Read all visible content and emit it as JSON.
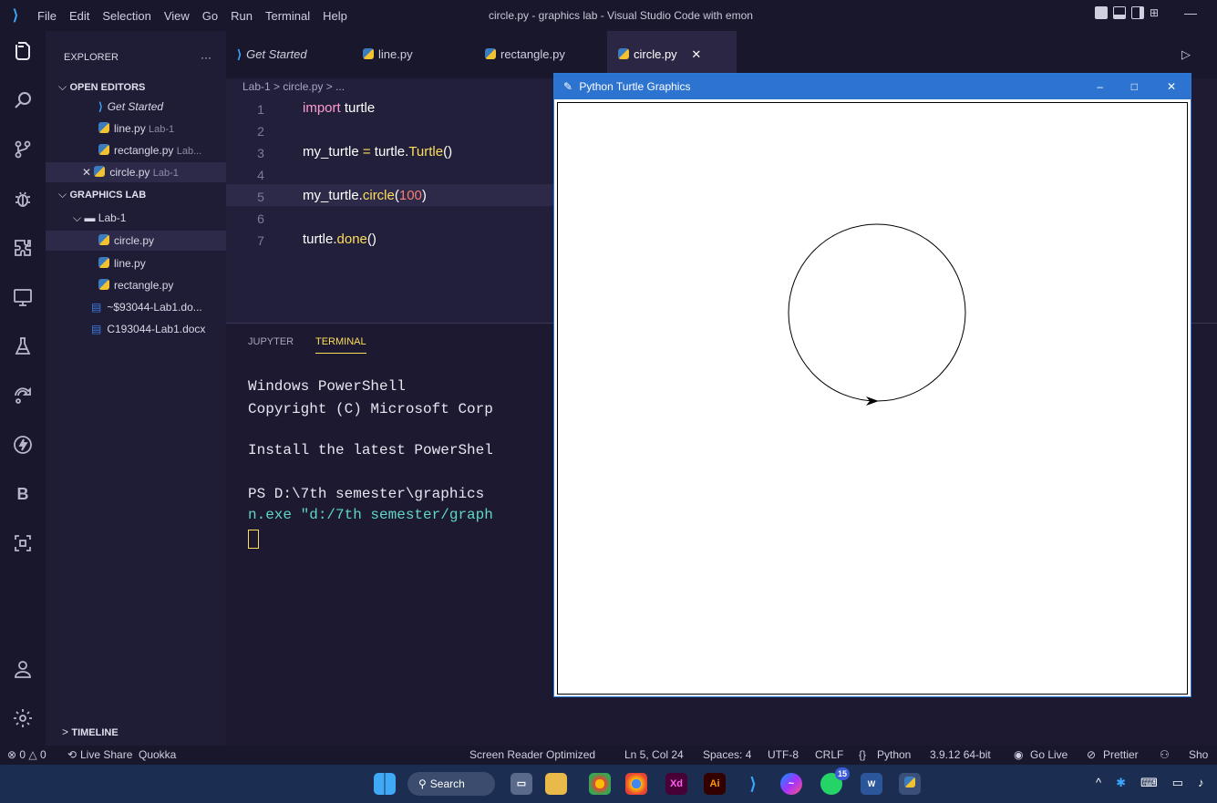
{
  "titlebar": {
    "menu": [
      "File",
      "Edit",
      "Selection",
      "View",
      "Go",
      "Run",
      "Terminal",
      "Help"
    ],
    "title": "circle.py - graphics lab - Visual Studio Code with emon"
  },
  "sidebar": {
    "explorer_label": "EXPLORER",
    "more": "···",
    "open_editors": "OPEN EDITORS",
    "open_items": [
      {
        "name": "Get Started",
        "desc": ""
      },
      {
        "name": "line.py",
        "desc": "Lab-1"
      },
      {
        "name": "rectangle.py",
        "desc": "Lab..."
      },
      {
        "name": "circle.py",
        "desc": "Lab-1"
      }
    ],
    "workspace": "GRAPHICS LAB",
    "folder": "Lab-1",
    "files": [
      "circle.py",
      "line.py",
      "rectangle.py"
    ],
    "docs": [
      "~$93044-Lab1.do...",
      "C193044-Lab1.docx"
    ],
    "timeline": "TIMELINE"
  },
  "tabs": [
    "Get Started",
    "line.py",
    "rectangle.py",
    "circle.py"
  ],
  "editor": {
    "breadcrumb": "Lab-1 > circle.py > ...",
    "line_numbers": [
      "1",
      "2",
      "3",
      "4",
      "5",
      "6",
      "7"
    ]
  },
  "panel": {
    "tabs": [
      "JUPYTER",
      "TERMINAL"
    ],
    "lines": [
      "Windows PowerShell",
      "Copyright (C) Microsoft Corp",
      "",
      "Install the latest PowerShel",
      "",
      "PS D:\\7th semester\\graphics",
      "n.exe \"d:/7th semester/graph"
    ]
  },
  "status": {
    "problems": "⊗ 0 △ 0",
    "liveshare": "Live Share",
    "quokka": "Quokka",
    "screenreader": "Screen Reader Optimized",
    "position": "Ln 5, Col 24",
    "spaces": "Spaces: 4",
    "encoding": "UTF-8",
    "eol": "CRLF",
    "language": "Python",
    "interpreter": "3.9.12 64-bit",
    "golive": "Go Live",
    "prettier": "Prettier",
    "show": "Sho"
  },
  "taskbar": {
    "search": "Search",
    "badge": "15"
  },
  "turtle": {
    "title": "Python Turtle Graphics",
    "min": "–",
    "max": "□",
    "close": "✕"
  }
}
